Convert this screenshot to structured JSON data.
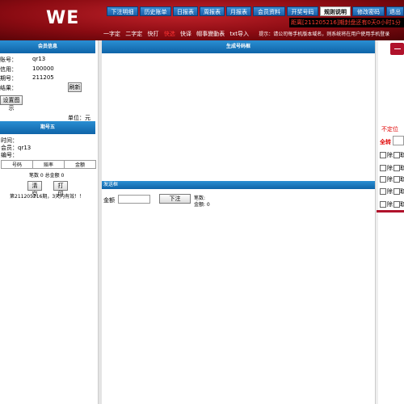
{
  "header": {
    "logo": "WE",
    "nav": [
      "下注明细",
      "历史账单",
      "日报表",
      "周报表",
      "月报表",
      "会员资料",
      "开奖号码",
      "规则说明",
      "修改密码",
      "退出"
    ],
    "active_nav": "规则说明",
    "notice": "距离[211205216]期封盘还有0天0小时1分",
    "subnav": [
      "一字定",
      "二字定",
      "快打",
      "快选",
      "快译",
      "帽事變動表",
      "txt导入"
    ],
    "subnav_red": "快选",
    "tip": "提示：请公司每手机版本域名，则系统将在用户使用手机登录"
  },
  "member_panel": {
    "title": "会员信息",
    "rows": [
      {
        "label": "账号：",
        "value": "qr13"
      },
      {
        "label": "信用：",
        "value": "100000"
      },
      {
        "label": "期号：",
        "value": "211205"
      },
      {
        "label": "结果：",
        "value": ""
      }
    ],
    "refresh": "刷新",
    "settings": "设置图示",
    "unit": "单位：元"
  },
  "period_panel": {
    "title": "期号五",
    "lines": [
      "时间：",
      "会员：qr13",
      "编号："
    ],
    "table_headers": [
      "号码",
      "赔率",
      "金额"
    ],
    "summary": "笔数 0  总金额 0",
    "clear": "清 空",
    "print": "打 印",
    "footer": "第211205216期，3天内有效！！"
  },
  "main": {
    "generate_title": "生成号码框",
    "download_title": "发送框",
    "amount_label": "金额",
    "submit": "下注",
    "count_label": "笔数:",
    "total_label": "金额: 0"
  },
  "right": {
    "red_label": "不定位",
    "all_label": "全转",
    "checks": [
      [
        "除",
        "取"
      ],
      [
        "除",
        "取"
      ],
      [
        "除",
        "取"
      ],
      [
        "除",
        "取"
      ],
      [
        "除",
        "取"
      ]
    ]
  }
}
